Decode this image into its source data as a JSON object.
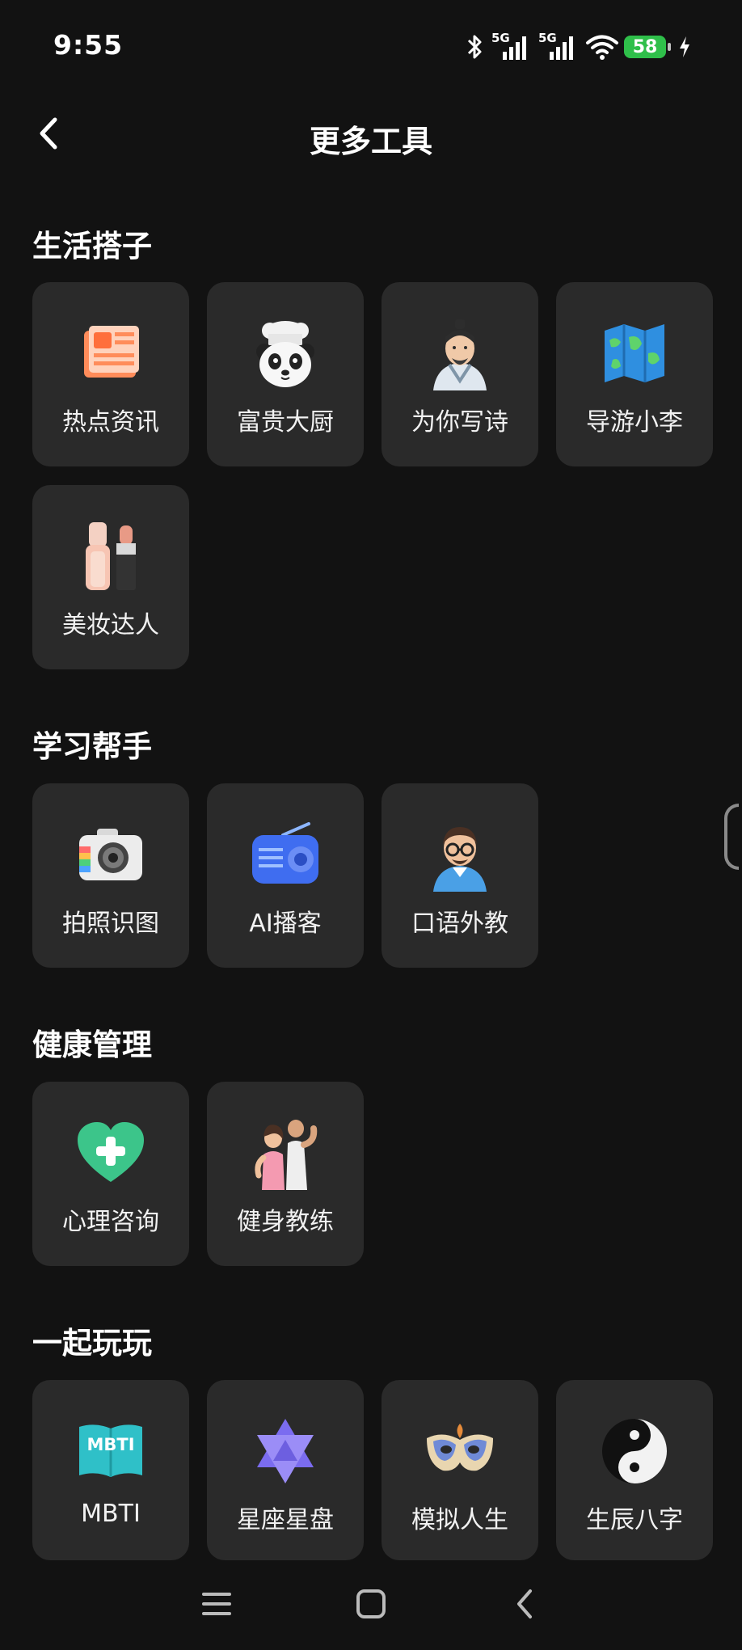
{
  "status_bar": {
    "time": "9:55",
    "battery": "58",
    "network1": "5G",
    "network2": "5G"
  },
  "header": {
    "title": "更多工具"
  },
  "sections": [
    {
      "title": "生活搭子",
      "items": [
        {
          "label": "热点资讯",
          "icon": "newspaper-icon"
        },
        {
          "label": "富贵大厨",
          "icon": "panda-chef-icon"
        },
        {
          "label": "为你写诗",
          "icon": "poet-icon"
        },
        {
          "label": "导游小李",
          "icon": "map-icon"
        },
        {
          "label": "美妆达人",
          "icon": "cosmetics-icon"
        }
      ]
    },
    {
      "title": "学习帮手",
      "items": [
        {
          "label": "拍照识图",
          "icon": "camera-icon"
        },
        {
          "label": "AI播客",
          "icon": "radio-icon"
        },
        {
          "label": "口语外教",
          "icon": "teacher-icon"
        }
      ]
    },
    {
      "title": "健康管理",
      "items": [
        {
          "label": "心理咨询",
          "icon": "heart-plus-icon"
        },
        {
          "label": "健身教练",
          "icon": "fitness-icon"
        }
      ]
    },
    {
      "title": "一起玩玩",
      "items": [
        {
          "label": "MBTI",
          "icon": "mbti-book-icon",
          "icon_text": "MBTI"
        },
        {
          "label": "星座星盘",
          "icon": "star-of-david-icon"
        },
        {
          "label": "模拟人生",
          "icon": "mask-icon"
        },
        {
          "label": "生辰八字",
          "icon": "yin-yang-icon"
        }
      ]
    }
  ],
  "colors": {
    "background": "#121212",
    "tile": "#2a2a2a",
    "battery": "#2fbf4a"
  }
}
